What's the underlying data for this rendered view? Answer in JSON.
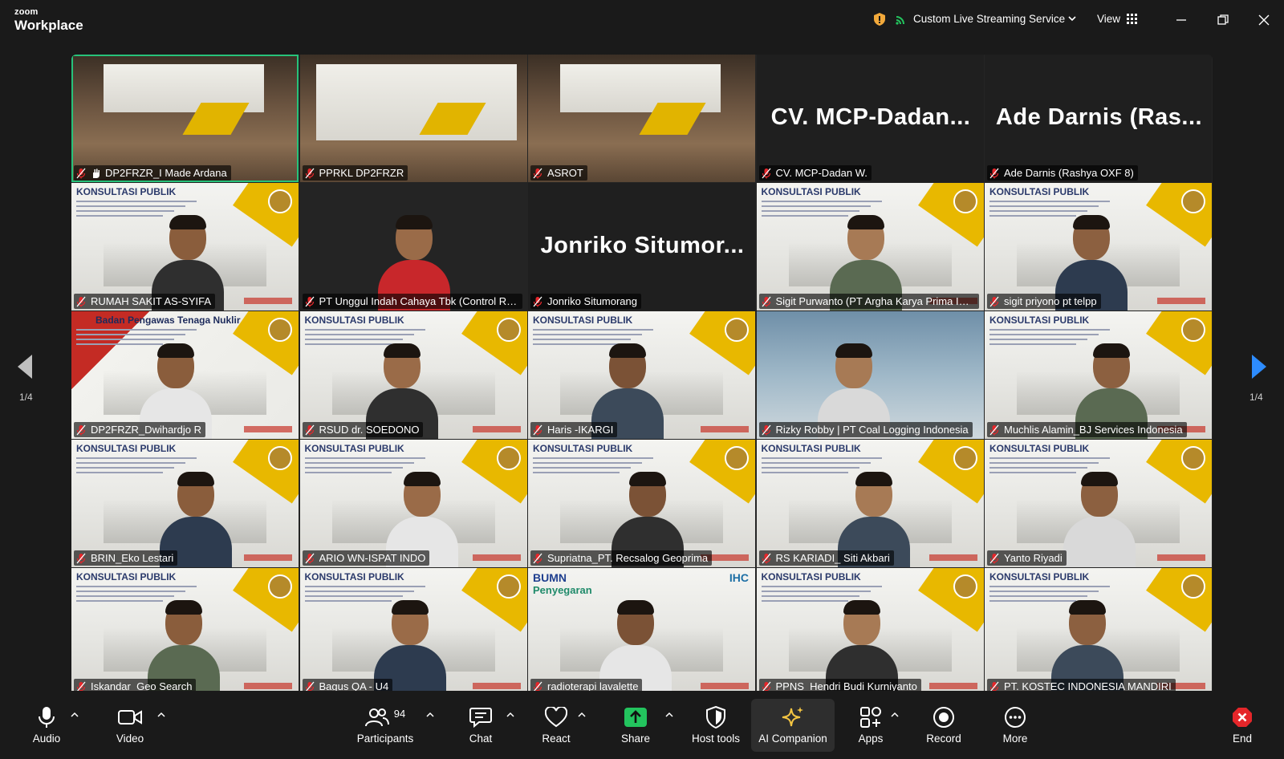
{
  "app": {
    "logo_top": "zoom",
    "logo_bottom": "Workplace"
  },
  "titlebar": {
    "stream_label": "Custom Live Streaming Service",
    "view_label": "View",
    "icons": [
      "shield-icon",
      "stream-icon",
      "chevron-down-icon",
      "grid-icon",
      "minimize-icon",
      "restore-icon",
      "close-icon"
    ]
  },
  "tiles": [
    {
      "name": "DP2FRZR_I Made Ardana",
      "big": ""
    },
    {
      "name": "PPRKL DP2FRZR",
      "big": ""
    },
    {
      "name": "ASROT",
      "big": ""
    },
    {
      "name": "CV. MCP-Dadan W.",
      "big": "CV. MCP-Dadan..."
    },
    {
      "name": "Ade Darnis (Rashya OXF 8)",
      "big": "Ade Darnis (Ras..."
    },
    {
      "name": "RUMAH SAKIT AS-SYIFA",
      "big": ""
    },
    {
      "name": "PT Unggul Indah Cahaya Tbk (Control Ro...",
      "big": ""
    },
    {
      "name": "Jonriko Situmorang",
      "big": "Jonriko Situmor..."
    },
    {
      "name": "Sigit Purwanto (PT Argha Karya Prima Ind...",
      "big": ""
    },
    {
      "name": "sigit priyono pt telpp",
      "big": ""
    },
    {
      "name": "DP2FRZR_Dwihardjo R",
      "big": ""
    },
    {
      "name": "RSUD dr. SOEDONO",
      "big": ""
    },
    {
      "name": "Haris -IKARGI",
      "big": ""
    },
    {
      "name": "Rizky Robby | PT Coal Logging Indonesia",
      "big": ""
    },
    {
      "name": "Muchlis Alamin_BJ Services Indonesia",
      "big": ""
    },
    {
      "name": "BRIN_Eko Lestari",
      "big": ""
    },
    {
      "name": "ARIO WN-ISPAT INDO",
      "big": ""
    },
    {
      "name": "Supriatna_PT. Recsalog Geoprima",
      "big": ""
    },
    {
      "name": "RS KARIADI_ Siti Akbari",
      "big": ""
    },
    {
      "name": "Yanto Riyadi",
      "big": ""
    },
    {
      "name": "Iskandar_Geo Search",
      "big": ""
    },
    {
      "name": "Bagus QA - U4",
      "big": ""
    },
    {
      "name": "radioterapi lavalette",
      "big": ""
    },
    {
      "name": "PPNS_Hendri Budi Kurniyanto",
      "big": ""
    },
    {
      "name": "PT. KOSTEC INDONESIA MANDIRI",
      "big": ""
    }
  ],
  "slide_text": {
    "konsultasi": "KONSULTASI PUBLIK",
    "bapeten_header": "Badan Pengawas Tenaga Nuklir",
    "bumn": "BUMN",
    "penyegaran": "Penyegaran",
    "ihc": "IHC"
  },
  "pager": {
    "left": "1/4",
    "right": "1/4"
  },
  "toolbar": {
    "audio": "Audio",
    "video": "Video",
    "participants": "Participants",
    "participants_count": "94",
    "chat": "Chat",
    "react": "React",
    "share": "Share",
    "host_tools": "Host tools",
    "ai_companion": "AI Companion",
    "apps": "Apps",
    "record": "Record",
    "more": "More",
    "end": "End"
  },
  "colors": {
    "active_speaker": "#27c27a",
    "share": "#23c45e",
    "end": "#e5262a",
    "muted": "#e5262a",
    "nav_arrow": "#2d8cff",
    "ai_spark": "#f4c542"
  }
}
